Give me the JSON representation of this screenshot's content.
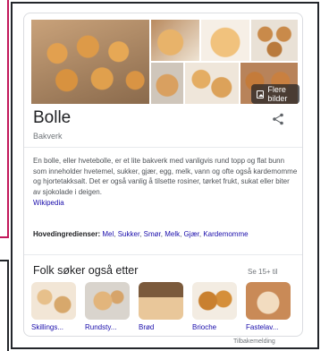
{
  "collage": {
    "more_images_label": "Flere bilder",
    "more_images_icon": "image-icon"
  },
  "entity": {
    "title": "Bolle",
    "subtitle": "Bakverk",
    "share_icon": "share-icon"
  },
  "description": {
    "text": "En bolle, eller hvetebolle, er et lite bakverk med vanligvis rund topp og flat bunn som inneholder hvetemel, sukker, gjær, egg, melk, vann og ofte også kardemomme og hjortetakksalt. Det er også vanlig å tilsette rosiner, tørket frukt, sukat eller biter av sjokolade i deigen.",
    "source_link": "Wikipedia"
  },
  "ingredients": {
    "label": "Hovedingredienser:",
    "items": [
      "Mel",
      "Sukker",
      "Smør",
      "Melk",
      "Gjær",
      "Kardemomme"
    ]
  },
  "people_also_search": {
    "title": "Folk søker også etter",
    "see_more": "Se 15+ til",
    "items": [
      {
        "label": "Skillings..."
      },
      {
        "label": "Rundsty..."
      },
      {
        "label": "Brød"
      },
      {
        "label": "Brioche"
      },
      {
        "label": "Fastelav..."
      }
    ]
  },
  "feedback": "Tilbakemelding",
  "colors": {
    "link": "#1a0dab",
    "title": "#202124",
    "muted": "#70757a",
    "border": "#dadce0",
    "frame": "#23262b",
    "accent_frame": "#c2185b"
  }
}
